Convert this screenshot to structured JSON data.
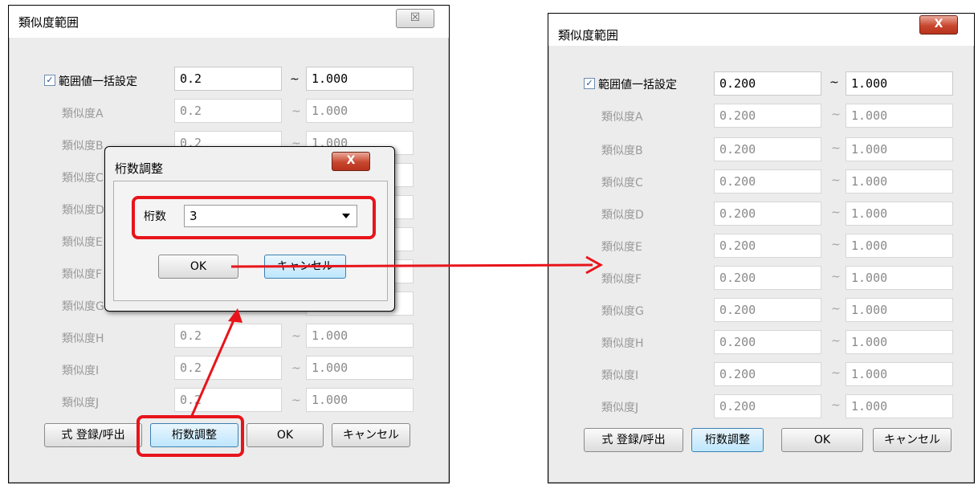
{
  "left_dialog": {
    "title": "類似度範囲",
    "close_glyph": "☒",
    "bulk_row": {
      "label": "範囲値一括設定",
      "checked": true,
      "check_glyph": "✓",
      "from": "0.2",
      "tilde": "~",
      "to": "1.000"
    },
    "rows": [
      {
        "label": "類似度A",
        "from": "0.2",
        "to": "1.000"
      },
      {
        "label": "類似度B",
        "from": "0.2",
        "to": "1.000"
      },
      {
        "label": "類似度C",
        "from": "",
        "to": ""
      },
      {
        "label": "類似度D",
        "from": "",
        "to": ""
      },
      {
        "label": "類似度E",
        "from": "",
        "to": ""
      },
      {
        "label": "類似度F",
        "from": "",
        "to": ""
      },
      {
        "label": "類似度G",
        "from": "",
        "to": ""
      },
      {
        "label": "類似度H",
        "from": "0.2",
        "to": "1.000"
      },
      {
        "label": "類似度I",
        "from": "0.2",
        "to": "1.000"
      },
      {
        "label": "類似度J",
        "from": "0.2",
        "to": "1.000"
      }
    ],
    "row_tilde": "~",
    "buttons": {
      "formula": "式 登録/呼出",
      "digits": "桁数調整",
      "ok": "OK",
      "cancel": "キャンセル"
    }
  },
  "digits_dialog": {
    "title": "桁数調整",
    "close_glyph": "X",
    "digits_label": "桁数",
    "digits_value": "3",
    "ok": "OK",
    "cancel": "キャンセル"
  },
  "right_dialog": {
    "title": "類似度範囲",
    "close_glyph": "X",
    "bulk_row": {
      "label": "範囲値一括設定",
      "checked": true,
      "check_glyph": "✓",
      "from": "0.200",
      "tilde": "~",
      "to": "1.000"
    },
    "rows": [
      {
        "label": "類似度A",
        "from": "0.200",
        "to": "1.000"
      },
      {
        "label": "類似度B",
        "from": "0.200",
        "to": "1.000"
      },
      {
        "label": "類似度C",
        "from": "0.200",
        "to": "1.000"
      },
      {
        "label": "類似度D",
        "from": "0.200",
        "to": "1.000"
      },
      {
        "label": "類似度E",
        "from": "0.200",
        "to": "1.000"
      },
      {
        "label": "類似度F",
        "from": "0.200",
        "to": "1.000"
      },
      {
        "label": "類似度G",
        "from": "0.200",
        "to": "1.000"
      },
      {
        "label": "類似度H",
        "from": "0.200",
        "to": "1.000"
      },
      {
        "label": "類似度I",
        "from": "0.200",
        "to": "1.000"
      },
      {
        "label": "類似度J",
        "from": "0.200",
        "to": "1.000"
      }
    ],
    "row_tilde": "~",
    "buttons": {
      "formula": "式 登録/呼出",
      "digits": "桁数調整",
      "ok": "OK",
      "cancel": "キャンセル"
    }
  },
  "colors": {
    "highlight": "#e8141b",
    "arrow": "#e8141b",
    "dialog_bg": "#ececec"
  }
}
